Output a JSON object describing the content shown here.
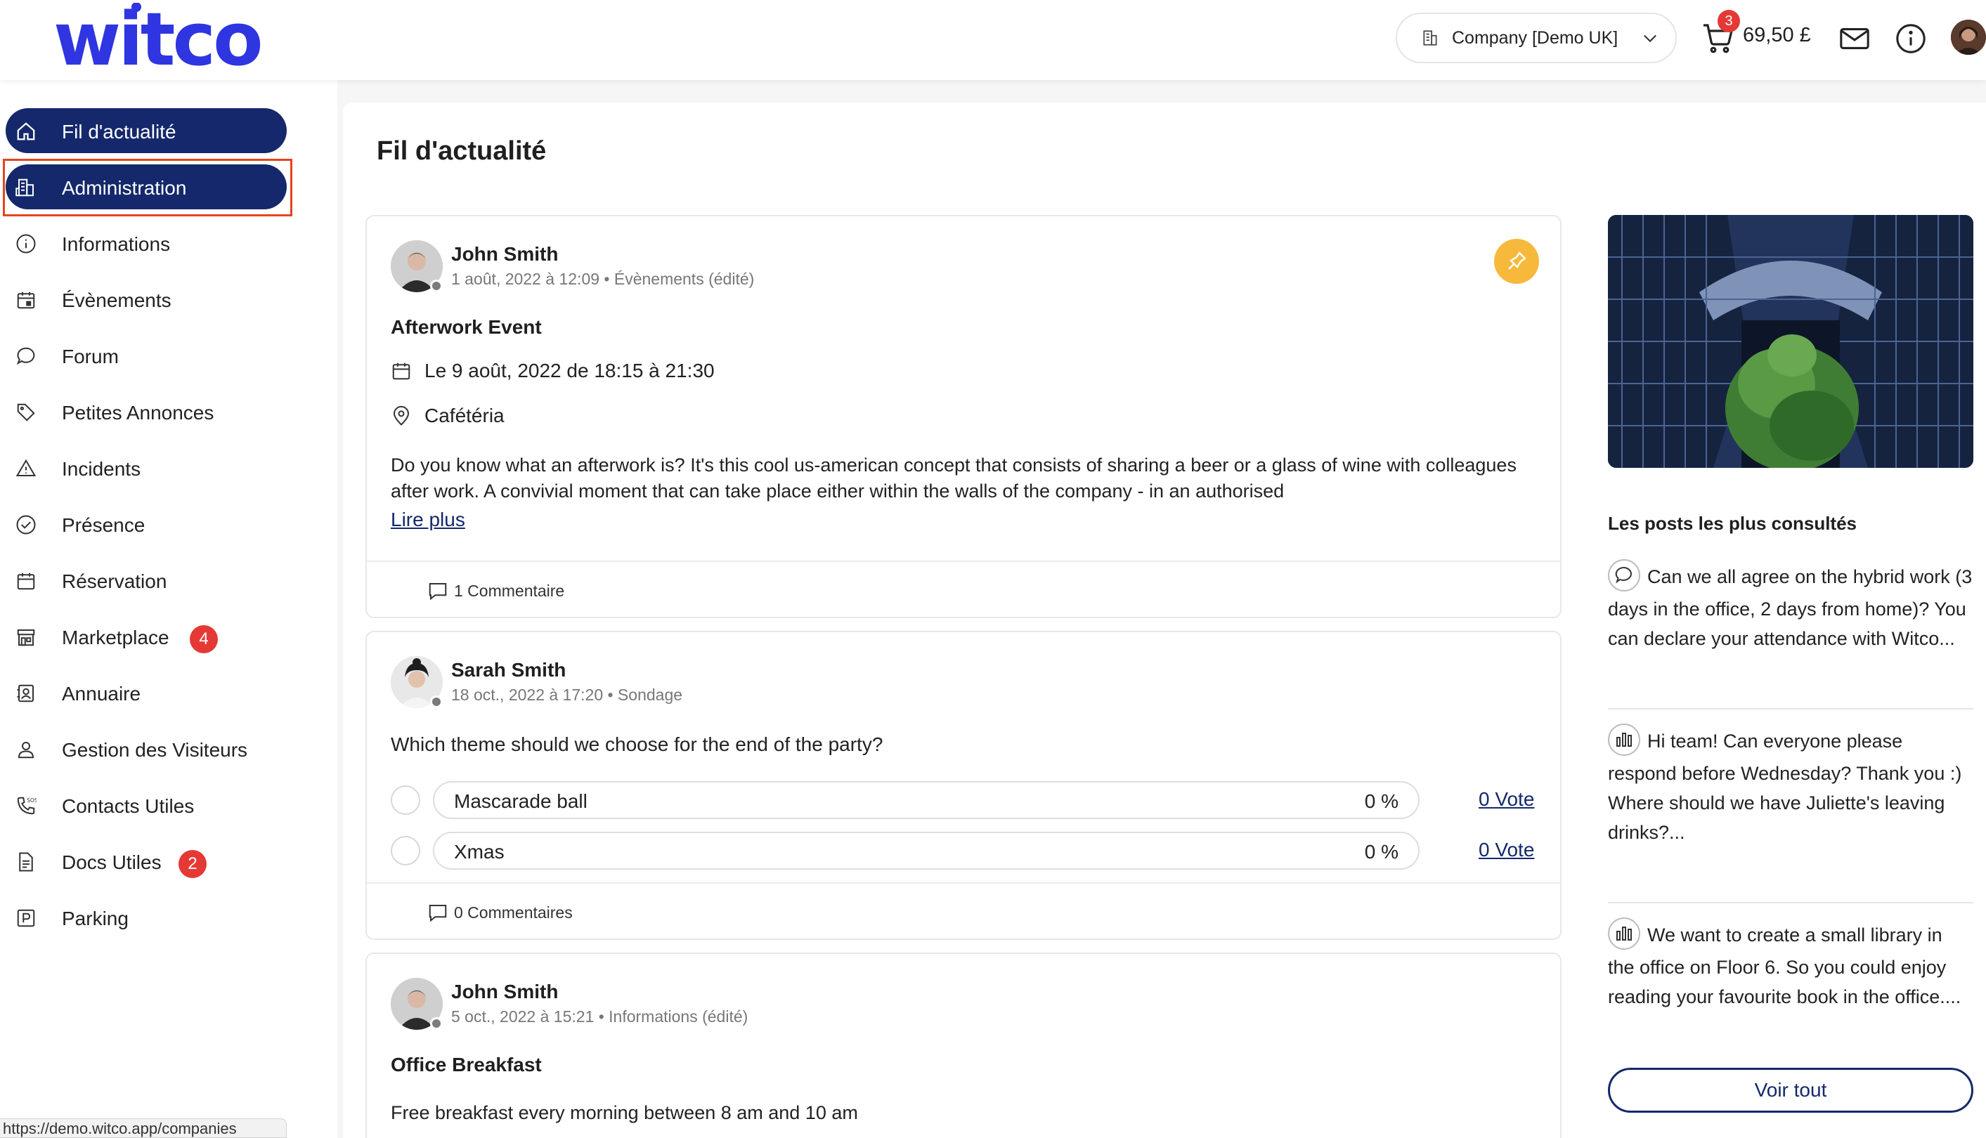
{
  "header": {
    "logo_text": "witco",
    "company_select": "Company [Demo UK]",
    "cart_count": "3",
    "cart_amount": "69,50 £",
    "brand_color": "#2f35e0",
    "navy": "#14286b"
  },
  "sidebar": {
    "items": [
      {
        "label": "Fil d'actualité",
        "icon": "home-icon"
      },
      {
        "label": "Administration",
        "icon": "building-icon"
      },
      {
        "label": "Informations",
        "icon": "info-icon"
      },
      {
        "label": "Évènements",
        "icon": "calendar-event-icon"
      },
      {
        "label": "Forum",
        "icon": "chat-bubble-icon"
      },
      {
        "label": "Petites Annonces",
        "icon": "tag-icon"
      },
      {
        "label": "Incidents",
        "icon": "warning-icon"
      },
      {
        "label": "Présence",
        "icon": "check-circle-icon"
      },
      {
        "label": "Réservation",
        "icon": "calendar-icon"
      },
      {
        "label": "Marketplace",
        "icon": "store-icon",
        "badge": "4"
      },
      {
        "label": "Annuaire",
        "icon": "contact-book-icon"
      },
      {
        "label": "Gestion des Visiteurs",
        "icon": "visitor-icon"
      },
      {
        "label": "Contacts Utiles",
        "icon": "phone-sos-icon"
      },
      {
        "label": "Docs Utiles",
        "icon": "document-icon",
        "badge": "2"
      },
      {
        "label": "Parking",
        "icon": "parking-icon"
      }
    ]
  },
  "status_url": "https://demo.witco.app/companies",
  "main": {
    "title": "Fil d'actualité",
    "posts": [
      {
        "author": "John Smith",
        "meta": "1 août, 2022 à 12:09 • Évènements (édité)",
        "title": "Afterwork Event",
        "date_line": "Le 9 août, 2022 de 18:15 à 21:30",
        "location": "Cafétéria",
        "body": "Do you know what an afterwork is? It's this cool us-american concept that consists of sharing a beer or a glass of wine with colleagues after work. A convivial moment that can take place either within the walls of the company - in an authorised",
        "read_more": "Lire plus",
        "comments": "1 Commentaire"
      },
      {
        "author": "Sarah Smith",
        "meta": "18 oct., 2022 à 17:20 • Sondage",
        "question": "Which theme should we choose for the end of the party?",
        "options": [
          {
            "label": "Mascarade ball",
            "percent": "0 %",
            "votes": "0 Vote"
          },
          {
            "label": "Xmas",
            "percent": "0 %",
            "votes": "0 Vote"
          }
        ],
        "comments": "0 Commentaires"
      },
      {
        "author": "John Smith",
        "meta": "5 oct., 2022 à 15:21 • Informations (édité)",
        "title": "Office Breakfast",
        "body": "Free breakfast every morning between 8 am and 10 am"
      }
    ]
  },
  "right": {
    "most_viewed_title": "Les posts les plus consultés",
    "posts": [
      {
        "icon": "chat-bubble-icon",
        "text": "Can we all agree on the hybrid work (3 days in the office, 2 days from home)? You can declare your attendance with Witco..."
      },
      {
        "icon": "poll-icon",
        "text": "Hi team! Can everyone please respond before Wednesday? Thank you :)",
        "text2": "Where should we have Juliette's leaving drinks?..."
      },
      {
        "icon": "poll-icon",
        "text": "We want to create a small library in the office on Floor 6. So you could enjoy reading your favourite book in the office...."
      }
    ],
    "see_all": "Voir tout"
  }
}
